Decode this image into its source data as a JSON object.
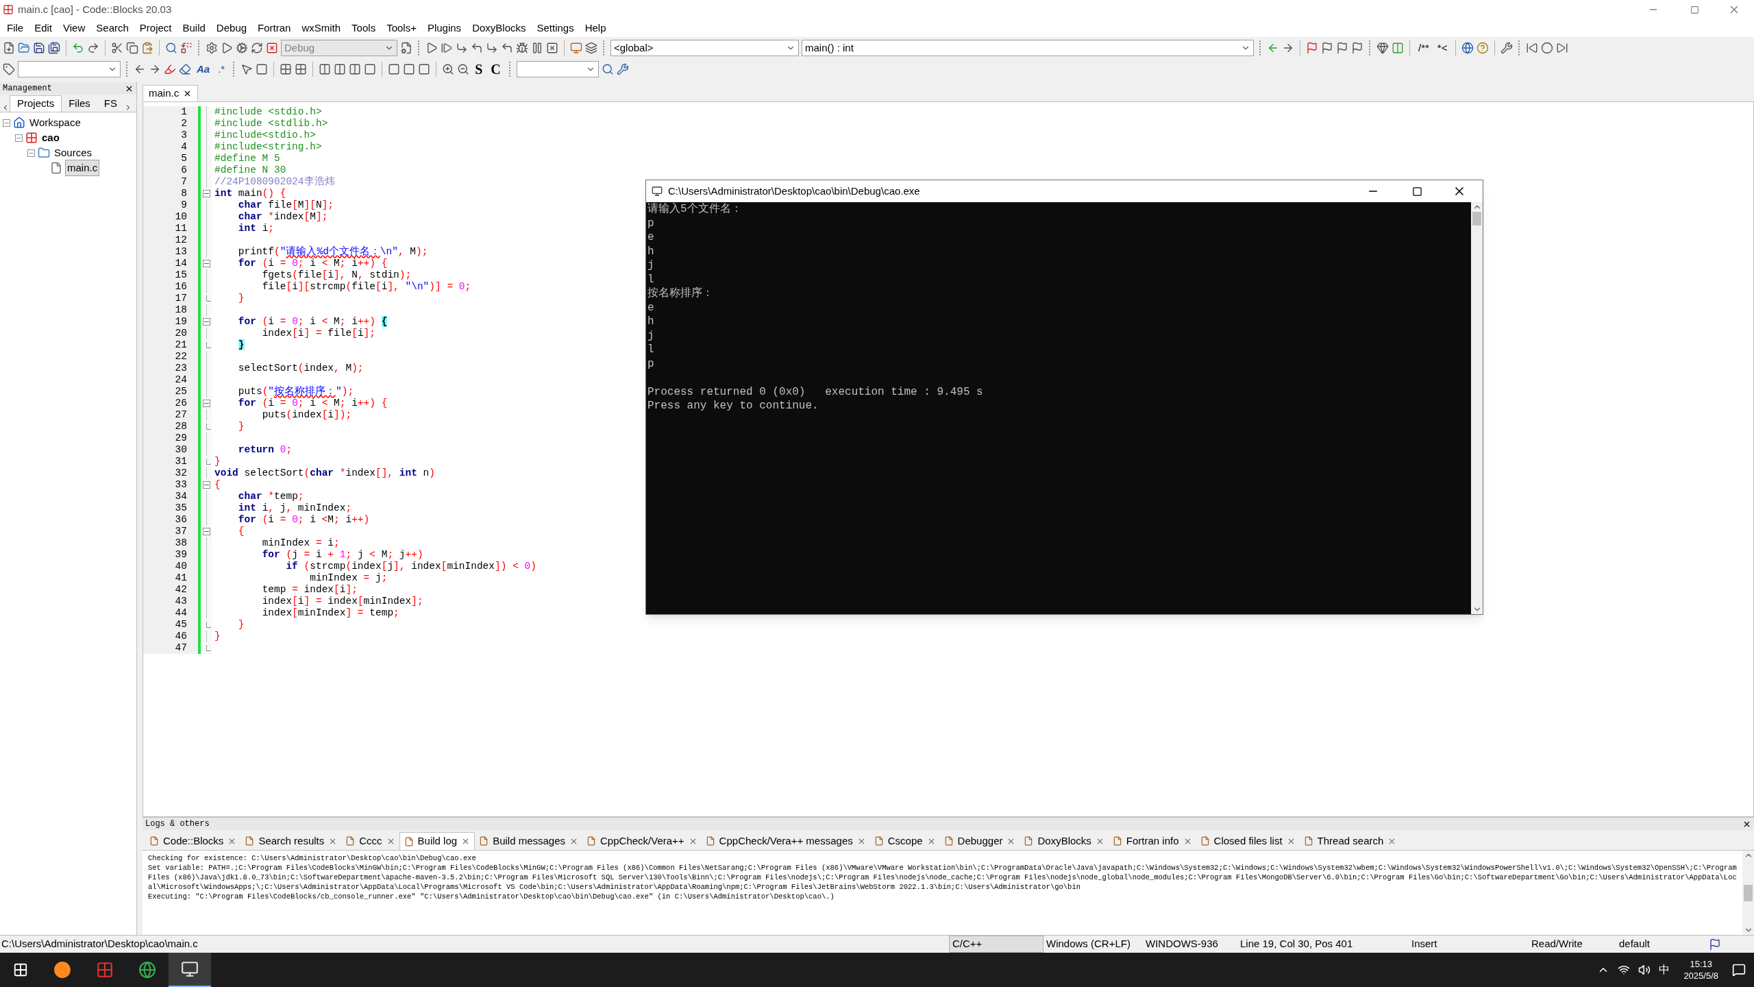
{
  "window": {
    "title": "main.c [cao] - Code::Blocks 20.03"
  },
  "menu": [
    "File",
    "Edit",
    "View",
    "Search",
    "Project",
    "Build",
    "Debug",
    "Fortran",
    "wxSmith",
    "Tools",
    "Tools+",
    "Plugins",
    "DoxyBlocks",
    "Settings",
    "Help"
  ],
  "toolbar": {
    "build_target": "Debug",
    "scope": "<global>",
    "function": "main() : int",
    "comment_glyphs": [
      "/**",
      "*<"
    ],
    "text_glyphs": [
      "Aa",
      ".*"
    ],
    "letter_glyphs": [
      "S",
      "C"
    ]
  },
  "management": {
    "title": "Management",
    "tabs": [
      {
        "label": "Projects",
        "selected": true
      },
      {
        "label": "Files",
        "selected": false
      },
      {
        "label": "FS",
        "selected": false
      }
    ],
    "tree": [
      {
        "label": "Workspace",
        "kind": "workspace",
        "selected": false,
        "children": [
          {
            "label": "cao",
            "kind": "project",
            "selected": false,
            "children": [
              {
                "label": "Sources",
                "kind": "folder",
                "selected": false,
                "children": [
                  {
                    "label": "main.c",
                    "kind": "file",
                    "selected": true
                  }
                ]
              }
            ]
          }
        ]
      }
    ]
  },
  "editor": {
    "tabs": [
      {
        "label": "main.c",
        "selected": true
      }
    ],
    "lines": [
      {
        "n": "1",
        "t": [
          {
            "kind": "p",
            "text": "#include <stdio.h>"
          }
        ]
      },
      {
        "n": "2",
        "t": [
          {
            "kind": "p",
            "text": "#include <stdlib.h>"
          }
        ]
      },
      {
        "n": "3",
        "t": [
          {
            "kind": "p",
            "text": "#include<stdio.h>"
          }
        ]
      },
      {
        "n": "4",
        "t": [
          {
            "kind": "p",
            "text": "#include<string.h>"
          }
        ]
      },
      {
        "n": "5",
        "t": [
          {
            "kind": "p",
            "text": "#define M 5"
          }
        ]
      },
      {
        "n": "6",
        "t": [
          {
            "kind": "p",
            "text": "#define N 30"
          }
        ]
      },
      {
        "n": "7",
        "t": [
          {
            "kind": "c",
            "text": "//24P1080902024李浩炜"
          }
        ]
      },
      {
        "n": "8",
        "fold_start": true,
        "t": [
          {
            "kind": "k",
            "text": "int"
          },
          {
            "kind": "i",
            "text": " main"
          },
          {
            "kind": "o",
            "text": "() {"
          }
        ]
      },
      {
        "n": "9",
        "t": [
          {
            "kind": "k",
            "text": "    char"
          },
          {
            "kind": "i",
            "text": " file"
          },
          {
            "kind": "o",
            "text": "["
          },
          {
            "kind": "i",
            "text": "M"
          },
          {
            "kind": "o",
            "text": "]["
          },
          {
            "kind": "i",
            "text": "N"
          },
          {
            "kind": "o",
            "text": "];"
          }
        ]
      },
      {
        "n": "10",
        "t": [
          {
            "kind": "k",
            "text": "    char"
          },
          {
            "kind": "o",
            "text": " *"
          },
          {
            "kind": "i",
            "text": "index"
          },
          {
            "kind": "o",
            "text": "["
          },
          {
            "kind": "i",
            "text": "M"
          },
          {
            "kind": "o",
            "text": "];"
          }
        ]
      },
      {
        "n": "11",
        "t": [
          {
            "kind": "k",
            "text": "    int"
          },
          {
            "kind": "i",
            "text": " i"
          },
          {
            "kind": "o",
            "text": ";"
          }
        ]
      },
      {
        "n": "12"
      },
      {
        "n": "13",
        "t": [
          {
            "kind": "i",
            "text": "    printf"
          },
          {
            "kind": "o",
            "text": "("
          },
          {
            "kind": "s",
            "text": "\""
          },
          {
            "kind": "u",
            "text": "请输入%d个文件名："
          },
          {
            "kind": "s",
            "text": "\\n\""
          },
          {
            "kind": "o",
            "text": ","
          },
          {
            "kind": "i",
            "text": " M"
          },
          {
            "kind": "o",
            "text": ");"
          }
        ]
      },
      {
        "n": "14",
        "fold_start": true,
        "t": [
          {
            "kind": "k",
            "text": "    for"
          },
          {
            "kind": "o",
            "text": " ("
          },
          {
            "kind": "i",
            "text": "i "
          },
          {
            "kind": "o",
            "text": "= "
          },
          {
            "kind": "n",
            "text": "0"
          },
          {
            "kind": "o",
            "text": "; "
          },
          {
            "kind": "i",
            "text": "i "
          },
          {
            "kind": "o",
            "text": "< "
          },
          {
            "kind": "i",
            "text": "M"
          },
          {
            "kind": "o",
            "text": "; "
          },
          {
            "kind": "i",
            "text": "i"
          },
          {
            "kind": "o",
            "text": "++) {"
          }
        ]
      },
      {
        "n": "15",
        "t": [
          {
            "kind": "i",
            "text": "        fgets"
          },
          {
            "kind": "o",
            "text": "("
          },
          {
            "kind": "i",
            "text": "file"
          },
          {
            "kind": "o",
            "text": "["
          },
          {
            "kind": "i",
            "text": "i"
          },
          {
            "kind": "o",
            "text": "], "
          },
          {
            "kind": "i",
            "text": "N"
          },
          {
            "kind": "o",
            "text": ", "
          },
          {
            "kind": "i",
            "text": "stdin"
          },
          {
            "kind": "o",
            "text": ");"
          }
        ]
      },
      {
        "n": "16",
        "t": [
          {
            "kind": "i",
            "text": "        file"
          },
          {
            "kind": "o",
            "text": "["
          },
          {
            "kind": "i",
            "text": "i"
          },
          {
            "kind": "o",
            "text": "]["
          },
          {
            "kind": "i",
            "text": "strcmp"
          },
          {
            "kind": "o",
            "text": "("
          },
          {
            "kind": "i",
            "text": "file"
          },
          {
            "kind": "o",
            "text": "["
          },
          {
            "kind": "i",
            "text": "i"
          },
          {
            "kind": "o",
            "text": "], "
          },
          {
            "kind": "s",
            "text": "\"\\n\""
          },
          {
            "kind": "o",
            "text": ")] = "
          },
          {
            "kind": "n",
            "text": "0"
          },
          {
            "kind": "o",
            "text": ";"
          }
        ]
      },
      {
        "n": "17",
        "fold_end": true,
        "t": [
          {
            "kind": "o",
            "text": "    }"
          }
        ]
      },
      {
        "n": "18"
      },
      {
        "n": "19",
        "fold_start": true,
        "t": [
          {
            "kind": "k",
            "text": "    for"
          },
          {
            "kind": "o",
            "text": " ("
          },
          {
            "kind": "i",
            "text": "i "
          },
          {
            "kind": "o",
            "text": "= "
          },
          {
            "kind": "n",
            "text": "0"
          },
          {
            "kind": "o",
            "text": "; "
          },
          {
            "kind": "i",
            "text": "i "
          },
          {
            "kind": "o",
            "text": "< "
          },
          {
            "kind": "i",
            "text": "M"
          },
          {
            "kind": "o",
            "text": "; "
          },
          {
            "kind": "i",
            "text": "i"
          },
          {
            "kind": "o",
            "text": "++) "
          },
          {
            "kind": "m",
            "text": "{"
          }
        ]
      },
      {
        "n": "20",
        "t": [
          {
            "kind": "i",
            "text": "        index"
          },
          {
            "kind": "o",
            "text": "["
          },
          {
            "kind": "i",
            "text": "i"
          },
          {
            "kind": "o",
            "text": "] = "
          },
          {
            "kind": "i",
            "text": "file"
          },
          {
            "kind": "o",
            "text": "["
          },
          {
            "kind": "i",
            "text": "i"
          },
          {
            "kind": "o",
            "text": "];"
          }
        ]
      },
      {
        "n": "21",
        "fold_end": true,
        "t": [
          {
            "kind": "m",
            "text": "    }"
          }
        ]
      },
      {
        "n": "22"
      },
      {
        "n": "23",
        "t": [
          {
            "kind": "i",
            "text": "    selectSort"
          },
          {
            "kind": "o",
            "text": "("
          },
          {
            "kind": "i",
            "text": "index"
          },
          {
            "kind": "o",
            "text": ", "
          },
          {
            "kind": "i",
            "text": "M"
          },
          {
            "kind": "o",
            "text": ");"
          }
        ]
      },
      {
        "n": "24"
      },
      {
        "n": "25",
        "t": [
          {
            "kind": "i",
            "text": "    puts"
          },
          {
            "kind": "o",
            "text": "("
          },
          {
            "kind": "s",
            "text": "\""
          },
          {
            "kind": "u",
            "text": "按名称排序："
          },
          {
            "kind": "s",
            "text": "\""
          },
          {
            "kind": "o",
            "text": ");"
          }
        ]
      },
      {
        "n": "26",
        "fold_start": true,
        "t": [
          {
            "kind": "k",
            "text": "    for"
          },
          {
            "kind": "o",
            "text": " ("
          },
          {
            "kind": "i",
            "text": "i "
          },
          {
            "kind": "o",
            "text": "= "
          },
          {
            "kind": "n",
            "text": "0"
          },
          {
            "kind": "o",
            "text": "; "
          },
          {
            "kind": "i",
            "text": "i "
          },
          {
            "kind": "o",
            "text": "< "
          },
          {
            "kind": "i",
            "text": "M"
          },
          {
            "kind": "o",
            "text": "; "
          },
          {
            "kind": "i",
            "text": "i"
          },
          {
            "kind": "o",
            "text": "++) {"
          }
        ]
      },
      {
        "n": "27",
        "t": [
          {
            "kind": "i",
            "text": "        puts"
          },
          {
            "kind": "o",
            "text": "("
          },
          {
            "kind": "i",
            "text": "index"
          },
          {
            "kind": "o",
            "text": "["
          },
          {
            "kind": "i",
            "text": "i"
          },
          {
            "kind": "o",
            "text": "]);"
          }
        ]
      },
      {
        "n": "28",
        "fold_end": true,
        "t": [
          {
            "kind": "o",
            "text": "    }"
          }
        ]
      },
      {
        "n": "29"
      },
      {
        "n": "30",
        "t": [
          {
            "kind": "k",
            "text": "    return"
          },
          {
            "kind": "n",
            "text": " 0"
          },
          {
            "kind": "o",
            "text": ";"
          }
        ]
      },
      {
        "n": "31",
        "fold_end": true,
        "t": [
          {
            "kind": "o",
            "text": "}"
          }
        ]
      },
      {
        "n": "32",
        "t": [
          {
            "kind": "k",
            "text": "void"
          },
          {
            "kind": "i",
            "text": " selectSort"
          },
          {
            "kind": "o",
            "text": "("
          },
          {
            "kind": "k",
            "text": "char"
          },
          {
            "kind": "o",
            "text": " *"
          },
          {
            "kind": "i",
            "text": "index"
          },
          {
            "kind": "o",
            "text": "[], "
          },
          {
            "kind": "k",
            "text": "int"
          },
          {
            "kind": "i",
            "text": " n"
          },
          {
            "kind": "o",
            "text": ")"
          }
        ]
      },
      {
        "n": "33",
        "fold_start": true,
        "t": [
          {
            "kind": "o",
            "text": "{"
          }
        ]
      },
      {
        "n": "34",
        "t": [
          {
            "kind": "k",
            "text": "    char"
          },
          {
            "kind": "o",
            "text": " *"
          },
          {
            "kind": "i",
            "text": "temp"
          },
          {
            "kind": "o",
            "text": ";"
          }
        ]
      },
      {
        "n": "35",
        "t": [
          {
            "kind": "k",
            "text": "    int"
          },
          {
            "kind": "i",
            "text": " i"
          },
          {
            "kind": "o",
            "text": ", "
          },
          {
            "kind": "i",
            "text": "j"
          },
          {
            "kind": "o",
            "text": ", "
          },
          {
            "kind": "i",
            "text": "minIndex"
          },
          {
            "kind": "o",
            "text": ";"
          }
        ]
      },
      {
        "n": "36",
        "t": [
          {
            "kind": "k",
            "text": "    for"
          },
          {
            "kind": "o",
            "text": " ("
          },
          {
            "kind": "i",
            "text": "i "
          },
          {
            "kind": "o",
            "text": "= "
          },
          {
            "kind": "n",
            "text": "0"
          },
          {
            "kind": "o",
            "text": "; "
          },
          {
            "kind": "i",
            "text": "i "
          },
          {
            "kind": "o",
            "text": "<"
          },
          {
            "kind": "i",
            "text": "M"
          },
          {
            "kind": "o",
            "text": "; "
          },
          {
            "kind": "i",
            "text": "i"
          },
          {
            "kind": "o",
            "text": "++)"
          }
        ]
      },
      {
        "n": "37",
        "fold_start": true,
        "t": [
          {
            "kind": "o",
            "text": "    {"
          }
        ]
      },
      {
        "n": "38",
        "t": [
          {
            "kind": "i",
            "text": "        minIndex "
          },
          {
            "kind": "o",
            "text": "= "
          },
          {
            "kind": "i",
            "text": "i"
          },
          {
            "kind": "o",
            "text": ";"
          }
        ]
      },
      {
        "n": "39",
        "t": [
          {
            "kind": "k",
            "text": "        for"
          },
          {
            "kind": "o",
            "text": " ("
          },
          {
            "kind": "i",
            "text": "j "
          },
          {
            "kind": "o",
            "text": "= "
          },
          {
            "kind": "i",
            "text": "i "
          },
          {
            "kind": "o",
            "text": "+ "
          },
          {
            "kind": "n",
            "text": "1"
          },
          {
            "kind": "o",
            "text": "; "
          },
          {
            "kind": "i",
            "text": "j "
          },
          {
            "kind": "o",
            "text": "< "
          },
          {
            "kind": "i",
            "text": "M"
          },
          {
            "kind": "o",
            "text": "; "
          },
          {
            "kind": "i",
            "text": "j"
          },
          {
            "kind": "o",
            "text": "++)"
          }
        ]
      },
      {
        "n": "40",
        "t": [
          {
            "kind": "k",
            "text": "            if"
          },
          {
            "kind": "o",
            "text": " ("
          },
          {
            "kind": "i",
            "text": "strcmp"
          },
          {
            "kind": "o",
            "text": "("
          },
          {
            "kind": "i",
            "text": "index"
          },
          {
            "kind": "o",
            "text": "["
          },
          {
            "kind": "i",
            "text": "j"
          },
          {
            "kind": "o",
            "text": "], "
          },
          {
            "kind": "i",
            "text": "index"
          },
          {
            "kind": "o",
            "text": "["
          },
          {
            "kind": "i",
            "text": "minIndex"
          },
          {
            "kind": "o",
            "text": "]) < "
          },
          {
            "kind": "n",
            "text": "0"
          },
          {
            "kind": "o",
            "text": ")"
          }
        ]
      },
      {
        "n": "41",
        "t": [
          {
            "kind": "i",
            "text": "                minIndex "
          },
          {
            "kind": "o",
            "text": "= "
          },
          {
            "kind": "i",
            "text": "j"
          },
          {
            "kind": "o",
            "text": ";"
          }
        ]
      },
      {
        "n": "42",
        "t": [
          {
            "kind": "i",
            "text": "        temp "
          },
          {
            "kind": "o",
            "text": "= "
          },
          {
            "kind": "i",
            "text": "index"
          },
          {
            "kind": "o",
            "text": "["
          },
          {
            "kind": "i",
            "text": "i"
          },
          {
            "kind": "o",
            "text": "];"
          }
        ]
      },
      {
        "n": "43",
        "t": [
          {
            "kind": "i",
            "text": "        index"
          },
          {
            "kind": "o",
            "text": "["
          },
          {
            "kind": "i",
            "text": "i"
          },
          {
            "kind": "o",
            "text": "] = "
          },
          {
            "kind": "i",
            "text": "index"
          },
          {
            "kind": "o",
            "text": "["
          },
          {
            "kind": "i",
            "text": "minIndex"
          },
          {
            "kind": "o",
            "text": "];"
          }
        ]
      },
      {
        "n": "44",
        "t": [
          {
            "kind": "i",
            "text": "        index"
          },
          {
            "kind": "o",
            "text": "["
          },
          {
            "kind": "i",
            "text": "minIndex"
          },
          {
            "kind": "o",
            "text": "] = "
          },
          {
            "kind": "i",
            "text": "temp"
          },
          {
            "kind": "o",
            "text": ";"
          }
        ]
      },
      {
        "n": "45",
        "fold_end": true,
        "t": [
          {
            "kind": "o",
            "text": "    }"
          }
        ]
      },
      {
        "n": "46",
        "t": [
          {
            "kind": "o",
            "text": "}"
          }
        ]
      },
      {
        "n": "47",
        "fold_end": true
      }
    ]
  },
  "console": {
    "title": "C:\\Users\\Administrator\\Desktop\\cao\\bin\\Debug\\cao.exe",
    "lines": [
      "请输入5个文件名：",
      "p",
      "e",
      "h",
      "j",
      "l",
      "按名称排序：",
      "e",
      "h",
      "j",
      "l",
      "p"
    ],
    "exit_lines": [
      "Process returned 0 (0x0)   execution time : 9.495 s",
      "Press any key to continue."
    ]
  },
  "logs": {
    "title": "Logs & others",
    "tabs": [
      {
        "label": "Code::Blocks",
        "selected": false
      },
      {
        "label": "Search results",
        "selected": false
      },
      {
        "label": "Cccc",
        "selected": false
      },
      {
        "label": "Build log",
        "selected": true
      },
      {
        "label": "Build messages",
        "selected": false
      },
      {
        "label": "CppCheck/Vera++",
        "selected": false
      },
      {
        "label": "CppCheck/Vera++ messages",
        "selected": false
      },
      {
        "label": "Cscope",
        "selected": false
      },
      {
        "label": "Debugger",
        "selected": false
      },
      {
        "label": "DoxyBlocks",
        "selected": false
      },
      {
        "label": "Fortran info",
        "selected": false
      },
      {
        "label": "Closed files list",
        "selected": false
      },
      {
        "label": "Thread search",
        "selected": false
      }
    ],
    "lines": [
      "Checking for existence: C:\\Users\\Administrator\\Desktop\\cao\\bin\\Debug\\cao.exe",
      "Set variable: PATH=.;C:\\Program Files\\CodeBlocks\\MinGW\\bin;C:\\Program Files\\CodeBlocks\\MinGW;C:\\Program Files (x86)\\Common Files\\NetSarang;C:\\Program Files (x86)\\VMware\\VMware Workstation\\bin\\;C:\\ProgramData\\Oracle\\Java\\javapath;C:\\Windows\\System32;C:\\Windows;C:\\Windows\\System32\\wbem;C:\\Windows\\System32\\WindowsPowerShell\\v1.0\\;C:\\Windows\\System32\\OpenSSH\\;C:\\Program Files (x86)\\Java\\jdk1.8.0_73\\bin;C:\\SoftwareDepartment\\apache-maven-3.5.2\\bin;C:\\Program Files\\Microsoft SQL Server\\130\\Tools\\Binn\\;C:\\Program Files\\nodejs\\;C:\\Program Files\\nodejs\\node_cache;C:\\Program Files\\nodejs\\node_global\\node_modules;C:\\Program Files\\MongoDB\\Server\\6.0\\bin;C:\\Program Files\\Go\\bin;C:\\SoftwareDepartment\\Go\\bin;C:\\Users\\Administrator\\AppData\\Local\\Microsoft\\WindowsApps;\\;C:\\Users\\Administrator\\AppData\\Local\\Programs\\Microsoft VS Code\\bin;C:\\Users\\Administrator\\AppData\\Roaming\\npm;C:\\Program Files\\JetBrains\\WebStorm 2022.1.3\\bin;C:\\Users\\Administrator\\go\\bin",
      "Executing: \"C:\\Program Files\\CodeBlocks/cb_console_runner.exe\" \"C:\\Users\\Administrator\\Desktop\\cao\\bin\\Debug\\cao.exe\"  (in C:\\Users\\Administrator\\Desktop\\cao\\.)"
    ]
  },
  "status_bar": {
    "path": "C:\\Users\\Administrator\\Desktop\\cao\\main.c",
    "language": "C/C++",
    "line_endings": "Windows (CR+LF)",
    "encoding": "WINDOWS-936",
    "position": "Line 19, Col 30, Pos 401",
    "mode": "Insert",
    "access": "Read/Write",
    "profile": "default"
  },
  "taskbar": {
    "ime": "中",
    "time": "15:13",
    "date": "2025/5/8"
  }
}
